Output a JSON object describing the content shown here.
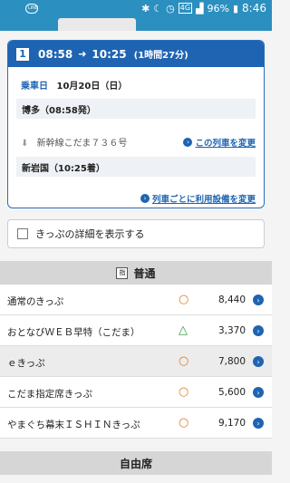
{
  "status_bar": {
    "line_badge": "LINE",
    "network": "4G",
    "battery": "96%",
    "time": "8:46"
  },
  "itinerary": {
    "number": "1",
    "depart": "08:58",
    "arrive": "10:25",
    "duration": "(1時間27分)",
    "date_label": "乗車日",
    "date_value": "10月20日（日）",
    "origin": "博多（08:58発）",
    "train": "新幹線こだま７３６号",
    "change_train": "この列車を変更",
    "destination": "新岩国（10:25着）",
    "change_facility": "列車ごとに利用設備を変更"
  },
  "ticket_detail": {
    "label": "きっぷの詳細を表示する"
  },
  "sections": {
    "ordinary": {
      "badge": "指",
      "title": "普通"
    },
    "unreserved": {
      "title": "自由席"
    }
  },
  "fares": [
    {
      "name": "通常のきっぷ",
      "mark": "○",
      "price": "8,440"
    },
    {
      "name": "おとなびＷＥＢ早特（こだま）",
      "mark": "△",
      "price": "3,370"
    },
    {
      "name": "ｅきっぷ",
      "mark": "○",
      "price": "7,800"
    },
    {
      "name": "こだま指定席きっぷ",
      "mark": "○",
      "price": "5,600"
    },
    {
      "name": "やまぐち幕末ＩＳＨＩＮきっぷ",
      "mark": "○",
      "price": "9,170"
    }
  ],
  "colors": {
    "brand": "#1f64b2",
    "status_bar": "#2b8fbf",
    "available": "#e07c1f",
    "few_left": "#3a9a3a"
  }
}
